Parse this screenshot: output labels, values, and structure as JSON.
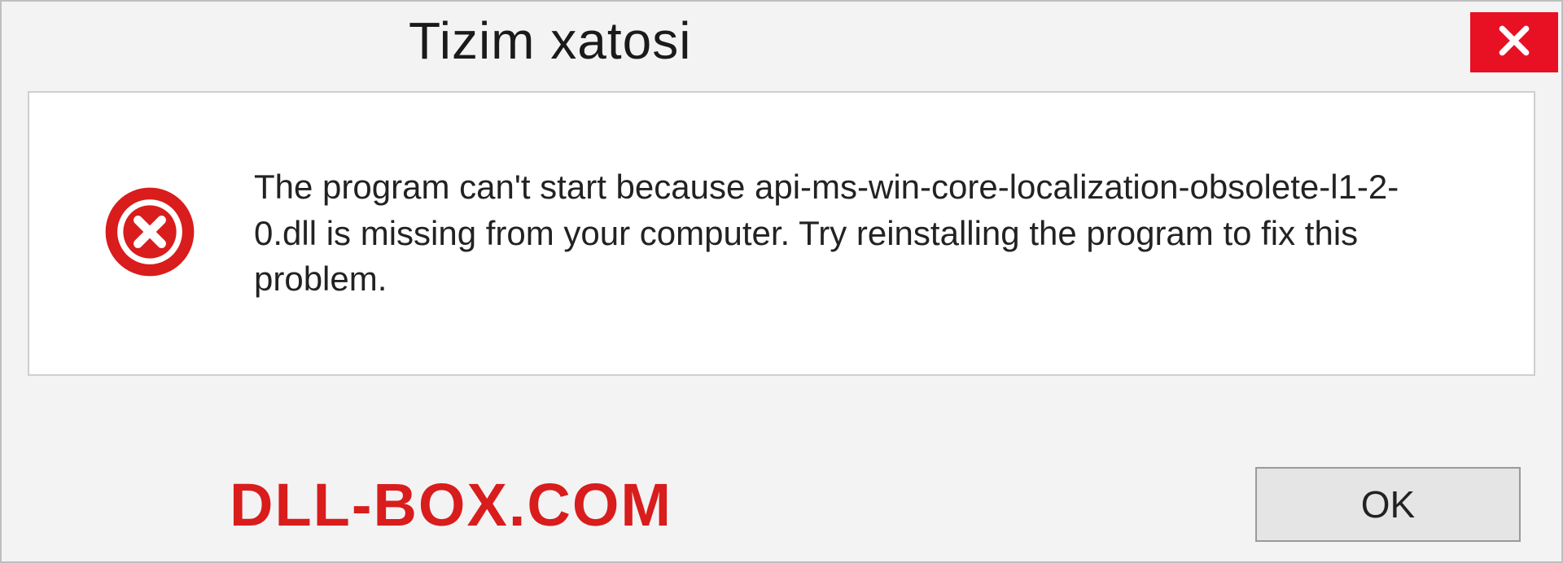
{
  "titlebar": {
    "title": "Tizim xatosi"
  },
  "content": {
    "message": "The program can't start because api-ms-win-core-localization-obsolete-l1-2-0.dll is missing from your computer. Try reinstalling the program to fix this problem."
  },
  "footer": {
    "watermark": "DLL-BOX.COM",
    "ok_label": "OK"
  },
  "colors": {
    "close_bg": "#e81123",
    "error_icon": "#d91c1c",
    "watermark": "#d91c1c"
  }
}
